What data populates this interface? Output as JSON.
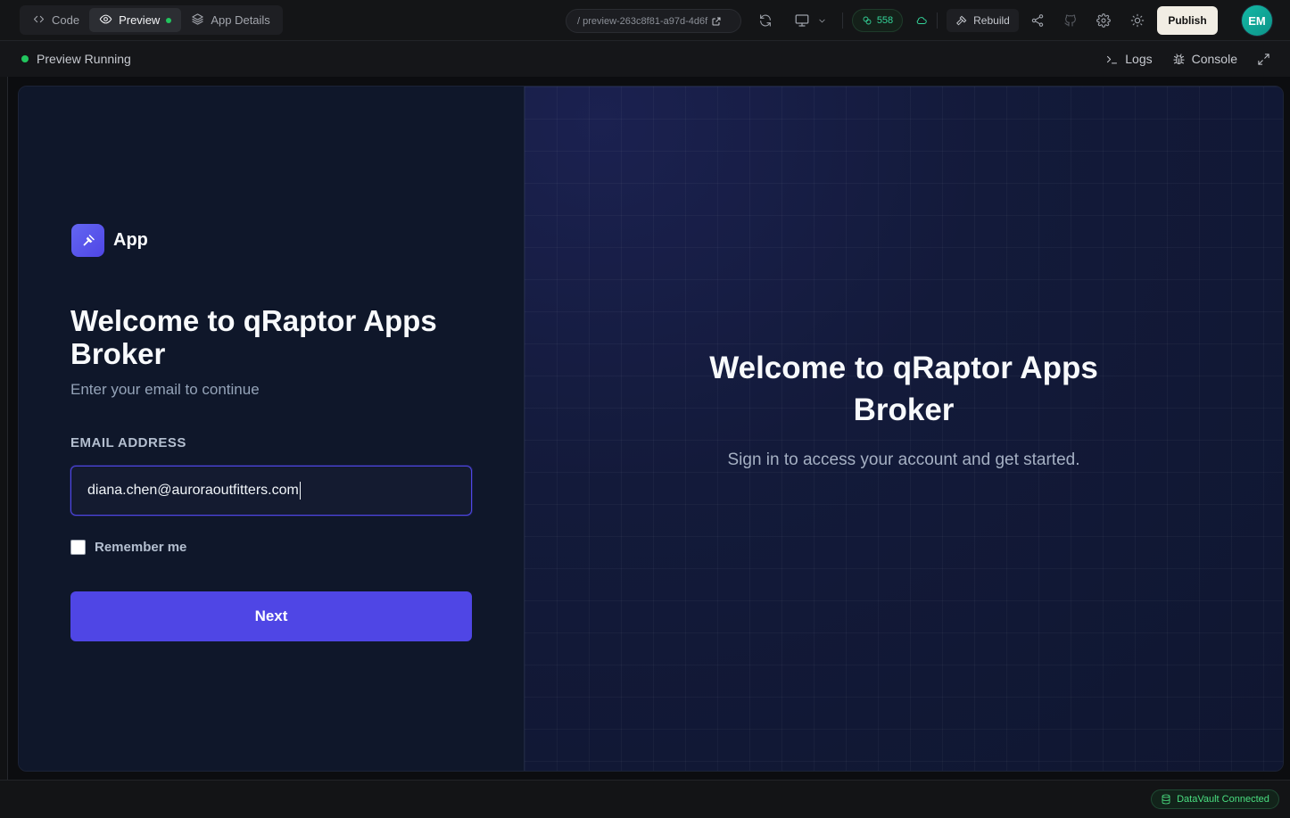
{
  "toolbar": {
    "tabs": [
      {
        "label": "Code",
        "icon": "code-icon"
      },
      {
        "label": "Preview",
        "icon": "eye-icon"
      },
      {
        "label": "App Details",
        "icon": "layers-icon"
      }
    ],
    "url": "/ preview-263c8f81-a97d-4d6f",
    "credits": "558",
    "rebuild_label": "Rebuild",
    "publish_label": "Publish",
    "avatar_initials": "EM"
  },
  "status": {
    "label": "Preview Running",
    "logs_label": "Logs",
    "console_label": "Console"
  },
  "login": {
    "app_name": "App",
    "title": "Welcome to qRaptor Apps Broker",
    "subtitle": "Enter your email to continue",
    "email_label": "EMAIL ADDRESS",
    "email_value": "diana.chen@auroraoutfitters.com",
    "remember_label": "Remember me",
    "next_label": "Next"
  },
  "hero": {
    "title_line1": "Welcome to qRaptor Apps",
    "title_line2": "Broker",
    "subtitle": "Sign in to access your account and get started."
  },
  "footer": {
    "datavault_label": "DataVault Connected"
  },
  "colors": {
    "accent": "#4f46e5",
    "success": "#22c55e",
    "panel": "#0f172a"
  }
}
